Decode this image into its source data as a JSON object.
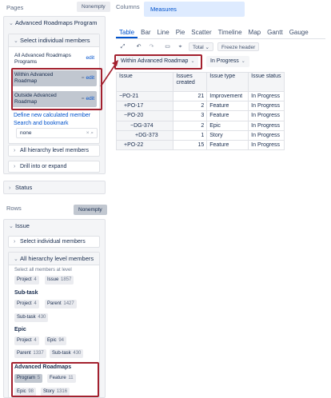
{
  "left": {
    "pages": {
      "title": "Pages",
      "nonempty": "Nonempty",
      "dimension": "Advanced Roadmaps Program",
      "select_individual": "Select individual members",
      "members": [
        {
          "label": "All Advanced Roadmaps Programs",
          "edit": "edit",
          "selected": false
        },
        {
          "label": "Within Advanced Roadmap",
          "edit": "edit",
          "selected": true
        },
        {
          "label": "Outside Advanced Roadmap",
          "edit": "edit",
          "selected": true
        }
      ],
      "define_link": "Define new calculated member",
      "search_link": "Search and bookmark",
      "search_value": "none",
      "all_hierarchy": "All hierarchy level members",
      "drill": "Drill into or expand",
      "status": "Status"
    },
    "rows": {
      "title": "Rows",
      "nonempty": "Nonempty",
      "dimension": "Issue",
      "select_individual": "Select individual members",
      "all_hierarchy": "All hierarchy level members",
      "hint": "Select all members at level",
      "top_tags": [
        {
          "label": "Project",
          "count": "4"
        },
        {
          "label": "Issue",
          "count": "1857"
        }
      ],
      "levels": [
        {
          "name": "Sub-task",
          "tags": [
            {
              "label": "Project",
              "count": "4"
            },
            {
              "label": "Parent",
              "count": "1427"
            },
            {
              "label": "Sub-task",
              "count": "430"
            }
          ]
        },
        {
          "name": "Epic",
          "tags": [
            {
              "label": "Project",
              "count": "4"
            },
            {
              "label": "Epic",
              "count": "94"
            },
            {
              "label": "Parent",
              "count": "1337"
            },
            {
              "label": "Sub-task",
              "count": "430"
            }
          ]
        },
        {
          "name": "Advanced Roadmaps",
          "tags": [
            {
              "label": "Program",
              "count": "5"
            },
            {
              "label": "Feature",
              "count": "11"
            },
            {
              "label": "Epic",
              "count": "98"
            },
            {
              "label": "Story",
              "count": "1316"
            }
          ]
        }
      ]
    }
  },
  "right": {
    "columns_label": "Columns",
    "measures": "Measures",
    "tabs": [
      "Table",
      "Bar",
      "Line",
      "Pie",
      "Scatter",
      "Timeline",
      "Map",
      "Gantt",
      "Gauge"
    ],
    "active_tab": "Table",
    "toolbar": {
      "expand_icon": "expand-icon",
      "undo_icon": "undo-icon",
      "redo_icon": "redo-icon",
      "comment_icon": "comment-icon",
      "pin_icon": "pin-icon",
      "total": "Total",
      "freeze": "Freeze header"
    },
    "filters": [
      "Within Advanced Roadmap",
      "In Progress"
    ],
    "table": {
      "headers": [
        "Issue",
        "Issues created",
        "Issue type",
        "Issue status"
      ],
      "rows": [
        {
          "issue": "PO-21",
          "prefix": "−",
          "indent": 0,
          "created": "21",
          "type": "Improvement",
          "status": "In Progress"
        },
        {
          "issue": "PO-17",
          "prefix": "+",
          "indent": 1,
          "created": "2",
          "type": "Feature",
          "status": "In Progress"
        },
        {
          "issue": "PO-20",
          "prefix": "−",
          "indent": 1,
          "created": "3",
          "type": "Feature",
          "status": "In Progress"
        },
        {
          "issue": "DG-374",
          "prefix": "−",
          "indent": 2,
          "created": "2",
          "type": "Epic",
          "status": "In Progress"
        },
        {
          "issue": "DG-373",
          "prefix": "+",
          "indent": 3,
          "created": "1",
          "type": "Story",
          "status": "In Progress"
        },
        {
          "issue": "PO-22",
          "prefix": "+",
          "indent": 1,
          "created": "15",
          "type": "Feature",
          "status": "In Progress"
        }
      ]
    }
  },
  "colors": {
    "highlight_red": "#a3202e",
    "accent_blue": "#0052cc",
    "selected_grey": "#c1c7d0"
  }
}
